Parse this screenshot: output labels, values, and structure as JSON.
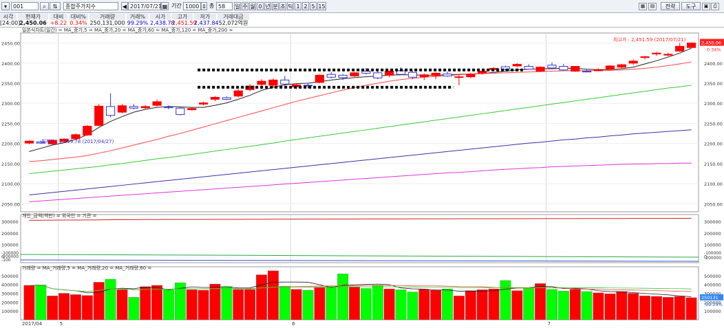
{
  "toolbar": {
    "code": "001",
    "name": "종합주가지수",
    "date": "2017/07/21",
    "period_label": "기간",
    "period_value": "1000",
    "count_label": "총",
    "count_value": "58",
    "timeframes": [
      "일",
      "주",
      "월",
      "0",
      "년",
      "분",
      "초",
      "틱",
      "1",
      "2",
      "5",
      "15"
    ],
    "right_buttons": [
      "전략",
      "도구"
    ],
    "right_icons": [
      "grid-icon",
      "table-icon",
      "refresh-icon",
      "save-icon",
      "print-icon",
      "settings-icon"
    ]
  },
  "quote": {
    "headers": [
      "시각",
      "현재가",
      "대비",
      "대비%",
      "거래량",
      "거래%",
      "시가",
      "고가",
      "저가",
      "거래대금"
    ],
    "values": [
      "[24:00]",
      "2,450.06",
      "+8.22",
      "0.34%",
      "250,131,000",
      "99.29%",
      "2,438.78",
      "2,451.59",
      "2,437.84",
      "52,072억원"
    ]
  },
  "price_panel": {
    "legend": "일본식차트(일간) = MA_종가,5 = MA_종가,20 = MA_종가,60 = MA_종가,120 = MA_종가,200 =",
    "high_note": "최고가 : 2,451.59 (2017/07/21)",
    "low_note": "최저가 : 2,199.78 (2017/04/27)",
    "last_label": "2,450.06",
    "change_label": "0.34%",
    "yticks": [
      "2450.00",
      "2400.00",
      "2350.00",
      "2300.00",
      "2250.00",
      "2200.00",
      "2150.00",
      "2100.00",
      "2050.00"
    ],
    "ytick_values": [
      2450,
      2400,
      2350,
      2300,
      2250,
      2200,
      2150,
      2100,
      2050
    ],
    "ylim": [
      2030,
      2475
    ]
  },
  "investor_panel": {
    "legend": "개인_금액(백만) = 외국인 = 기관 =",
    "yticks": [
      "300000",
      "200000",
      "100000",
      "0"
    ],
    "ytick_values": [
      300000,
      200000,
      100000,
      0
    ],
    "ylim": [
      -10000,
      360000
    ],
    "lower_yticks": [
      "-100000",
      "-200000",
      "-100"
    ],
    "right_lower_yticks": [
      "-100000",
      "-200000"
    ]
  },
  "volume_panel": {
    "legend": "거래량 = MA_거래량,5 = MA_거래량,20 = MA_거래량,60 =",
    "yticks": [
      "500000",
      "400000",
      "300000",
      "200000",
      "100000"
    ],
    "ytick_values": [
      500000,
      400000,
      300000,
      200000,
      100000
    ],
    "ylim": [
      0,
      600000
    ],
    "last_label": "250131",
    "pct_label": "99.29%"
  },
  "xaxis": {
    "labels": [
      "2017/04",
      "5",
      "6",
      "7"
    ],
    "label_index": [
      0,
      3,
      23,
      45
    ]
  },
  "colors": {
    "up": "#ff0000",
    "down": "#3333cc",
    "vol_up": "#ff0000",
    "vol_down": "#00ff00",
    "ma5": "#222222",
    "ma20": "#ff4444",
    "ma60": "#33cc33",
    "ma120": "#3333aa",
    "ma200": "#dd33dd"
  },
  "chart_data": {
    "type": "candlestick",
    "dates_range": [
      "2017/04",
      "2017/07/21"
    ],
    "candles": [
      {
        "o": 2201,
        "h": 2208,
        "l": 2198,
        "c": 2206
      },
      {
        "o": 2204,
        "h": 2207,
        "l": 2199,
        "c": 2201
      },
      {
        "o": 2199,
        "h": 2206,
        "l": 2196,
        "c": 2208
      },
      {
        "o": 2205,
        "h": 2213,
        "l": 2202,
        "c": 2211
      },
      {
        "o": 2212,
        "h": 2225,
        "l": 2210,
        "c": 2222
      },
      {
        "o": 2221,
        "h": 2246,
        "l": 2219,
        "c": 2243
      },
      {
        "o": 2245,
        "h": 2298,
        "l": 2243,
        "c": 2293
      },
      {
        "o": 2292,
        "h": 2325,
        "l": 2265,
        "c": 2270
      },
      {
        "o": 2278,
        "h": 2298,
        "l": 2275,
        "c": 2294
      },
      {
        "o": 2292,
        "h": 2298,
        "l": 2285,
        "c": 2288
      },
      {
        "o": 2289,
        "h": 2296,
        "l": 2284,
        "c": 2292
      },
      {
        "o": 2295,
        "h": 2309,
        "l": 2292,
        "c": 2304
      },
      {
        "o": 2291,
        "h": 2295,
        "l": 2285,
        "c": 2289
      },
      {
        "o": 2288,
        "h": 2292,
        "l": 2270,
        "c": 2272
      },
      {
        "o": 2284,
        "h": 2290,
        "l": 2282,
        "c": 2287
      },
      {
        "o": 2298,
        "h": 2304,
        "l": 2295,
        "c": 2301
      },
      {
        "o": 2310,
        "h": 2318,
        "l": 2305,
        "c": 2315
      },
      {
        "o": 2314,
        "h": 2317,
        "l": 2308,
        "c": 2310
      },
      {
        "o": 2318,
        "h": 2335,
        "l": 2315,
        "c": 2331
      },
      {
        "o": 2334,
        "h": 2348,
        "l": 2330,
        "c": 2343
      },
      {
        "o": 2347,
        "h": 2360,
        "l": 2335,
        "c": 2355
      },
      {
        "o": 2345,
        "h": 2362,
        "l": 2340,
        "c": 2358
      },
      {
        "o": 2358,
        "h": 2368,
        "l": 2344,
        "c": 2348
      },
      {
        "o": 2341,
        "h": 2349,
        "l": 2335,
        "c": 2346
      },
      {
        "o": 2345,
        "h": 2350,
        "l": 2338,
        "c": 2344
      },
      {
        "o": 2352,
        "h": 2372,
        "l": 2350,
        "c": 2370
      },
      {
        "o": 2372,
        "h": 2378,
        "l": 2362,
        "c": 2365
      },
      {
        "o": 2370,
        "h": 2373,
        "l": 2358,
        "c": 2364
      },
      {
        "o": 2368,
        "h": 2378,
        "l": 2366,
        "c": 2376
      },
      {
        "o": 2380,
        "h": 2388,
        "l": 2372,
        "c": 2375
      },
      {
        "o": 2376,
        "h": 2381,
        "l": 2360,
        "c": 2363
      },
      {
        "o": 2370,
        "h": 2382,
        "l": 2365,
        "c": 2380
      },
      {
        "o": 2381,
        "h": 2390,
        "l": 2371,
        "c": 2372
      },
      {
        "o": 2377,
        "h": 2381,
        "l": 2360,
        "c": 2365
      },
      {
        "o": 2366,
        "h": 2374,
        "l": 2358,
        "c": 2371
      },
      {
        "o": 2369,
        "h": 2377,
        "l": 2360,
        "c": 2375
      },
      {
        "o": 2373,
        "h": 2379,
        "l": 2366,
        "c": 2368
      },
      {
        "o": 2365,
        "h": 2370,
        "l": 2345,
        "c": 2366
      },
      {
        "o": 2366,
        "h": 2376,
        "l": 2362,
        "c": 2372
      },
      {
        "o": 2375,
        "h": 2382,
        "l": 2371,
        "c": 2380
      },
      {
        "o": 2384,
        "h": 2390,
        "l": 2380,
        "c": 2387
      },
      {
        "o": 2391,
        "h": 2394,
        "l": 2382,
        "c": 2385
      },
      {
        "o": 2393,
        "h": 2400,
        "l": 2390,
        "c": 2397
      },
      {
        "o": 2392,
        "h": 2397,
        "l": 2388,
        "c": 2385
      },
      {
        "o": 2380,
        "h": 2392,
        "l": 2378,
        "c": 2390
      },
      {
        "o": 2395,
        "h": 2402,
        "l": 2385,
        "c": 2388
      },
      {
        "o": 2392,
        "h": 2398,
        "l": 2380,
        "c": 2383
      },
      {
        "o": 2380,
        "h": 2392,
        "l": 2378,
        "c": 2392
      },
      {
        "o": 2380,
        "h": 2384,
        "l": 2377,
        "c": 2378
      },
      {
        "o": 2381,
        "h": 2387,
        "l": 2380,
        "c": 2384
      },
      {
        "o": 2385,
        "h": 2395,
        "l": 2383,
        "c": 2393
      },
      {
        "o": 2390,
        "h": 2398,
        "l": 2385,
        "c": 2396
      },
      {
        "o": 2400,
        "h": 2409,
        "l": 2396,
        "c": 2405
      },
      {
        "o": 2414,
        "h": 2418,
        "l": 2409,
        "c": 2416
      },
      {
        "o": 2423,
        "h": 2428,
        "l": 2418,
        "c": 2425
      },
      {
        "o": 2420,
        "h": 2426,
        "l": 2417,
        "c": 2422
      },
      {
        "o": 2430,
        "h": 2450,
        "l": 2428,
        "c": 2442
      },
      {
        "o": 2438.78,
        "h": 2451.59,
        "l": 2437.84,
        "c": 2450.06
      }
    ],
    "volume": [
      390000,
      395000,
      270000,
      300000,
      285000,
      275000,
      425000,
      460000,
      340000,
      255000,
      375000,
      390000,
      340000,
      420000,
      340000,
      335000,
      405000,
      375000,
      345000,
      345000,
      510000,
      555000,
      380000,
      345000,
      335000,
      370000,
      385000,
      520000,
      370000,
      355000,
      390000,
      350000,
      340000,
      315000,
      345000,
      335000,
      350000,
      270000,
      330000,
      340000,
      350000,
      445000,
      330000,
      355000,
      410000,
      345000,
      325000,
      345000,
      320000,
      305000,
      295000,
      320000,
      300000,
      270000,
      265000,
      255000,
      265000,
      250131
    ],
    "ma": {
      "ma5": [
        2180,
        2188,
        2196,
        2202,
        2210,
        2222,
        2240,
        2255,
        2267,
        2278,
        2285,
        2290,
        2292,
        2291,
        2290,
        2290,
        2295,
        2301,
        2310,
        2320,
        2332,
        2340,
        2346,
        2349,
        2350,
        2354,
        2358,
        2361,
        2364,
        2366,
        2368,
        2370,
        2371,
        2371,
        2370,
        2370,
        2371,
        2372,
        2373,
        2374,
        2377,
        2380,
        2383,
        2385,
        2386,
        2386,
        2387,
        2387,
        2385,
        2384,
        2384,
        2386,
        2390,
        2398,
        2406,
        2415,
        2425,
        2437
      ],
      "ma20": [
        2155,
        2157,
        2160,
        2163,
        2166,
        2170,
        2176,
        2182,
        2189,
        2196,
        2203,
        2210,
        2218,
        2225,
        2233,
        2241,
        2249,
        2257,
        2265,
        2273,
        2281,
        2289,
        2297,
        2305,
        2312,
        2319,
        2326,
        2333,
        2339,
        2345,
        2350,
        2355,
        2359,
        2362,
        2365,
        2367,
        2369,
        2371,
        2373,
        2374,
        2375,
        2376,
        2377,
        2378,
        2379,
        2380,
        2381,
        2381,
        2381,
        2382,
        2382,
        2383,
        2385,
        2387,
        2390,
        2394,
        2398,
        2403
      ],
      "ma60": [
        2125,
        2128,
        2131,
        2134,
        2137,
        2140,
        2143,
        2147,
        2150,
        2154,
        2158,
        2162,
        2165,
        2169,
        2173,
        2177,
        2181,
        2185,
        2189,
        2193,
        2197,
        2201,
        2206,
        2210,
        2214,
        2218,
        2222,
        2226,
        2230,
        2234,
        2238,
        2242,
        2246,
        2250,
        2254,
        2258,
        2262,
        2266,
        2270,
        2274,
        2278,
        2282,
        2286,
        2290,
        2294,
        2298,
        2302,
        2306,
        2310,
        2314,
        2318,
        2322,
        2326,
        2330,
        2334,
        2338,
        2341,
        2345
      ],
      "ma120": [
        2072,
        2075,
        2078,
        2081,
        2084,
        2087,
        2090,
        2093,
        2096,
        2099,
        2102,
        2105,
        2108,
        2111,
        2114,
        2117,
        2120,
        2123,
        2126,
        2129,
        2132,
        2135,
        2138,
        2141,
        2144,
        2147,
        2150,
        2153,
        2156,
        2159,
        2162,
        2165,
        2168,
        2171,
        2174,
        2177,
        2180,
        2183,
        2186,
        2189,
        2192,
        2195,
        2198,
        2201,
        2203,
        2206,
        2209,
        2211,
        2214,
        2216,
        2219,
        2221,
        2224,
        2226,
        2228,
        2230,
        2232,
        2234
      ],
      "ma200": [
        2055,
        2057,
        2059,
        2061,
        2063,
        2065,
        2067,
        2069,
        2071,
        2073,
        2075,
        2077,
        2079,
        2081,
        2083,
        2085,
        2087,
        2089,
        2091,
        2093,
        2095,
        2097,
        2099,
        2101,
        2103,
        2105,
        2107,
        2109,
        2111,
        2113,
        2115,
        2117,
        2119,
        2121,
        2123,
        2125,
        2127,
        2128,
        2130,
        2132,
        2134,
        2136,
        2137,
        2139,
        2140,
        2142,
        2143,
        2144,
        2145,
        2146,
        2147,
        2148,
        2149,
        2149,
        2150,
        2150,
        2151,
        2151
      ]
    },
    "investor_individual": [
      310000,
      311000,
      311500,
      312000,
      312500,
      313000,
      314000,
      315000,
      315500,
      316000,
      316500,
      317000,
      317200,
      317400,
      317600,
      317800,
      318000,
      318200,
      318400,
      318600,
      319000,
      319500,
      320000,
      320300,
      320500,
      320800,
      321000,
      321200,
      321400,
      321600,
      321800,
      322000,
      322200,
      322400,
      322600,
      322800,
      323000,
      323200,
      323400,
      323600,
      323800,
      324000,
      324200,
      324400,
      324600,
      324800,
      325000,
      325200,
      325400,
      325600,
      325800,
      326000,
      326200,
      326400,
      326600,
      326800,
      327000,
      327500
    ],
    "annotations": {
      "dashed_upper": {
        "from_index": 15,
        "to_index": 42,
        "y": 2383
      },
      "dashed_lower": {
        "from_index": 15,
        "to_index": 36,
        "y": 2340
      }
    }
  }
}
